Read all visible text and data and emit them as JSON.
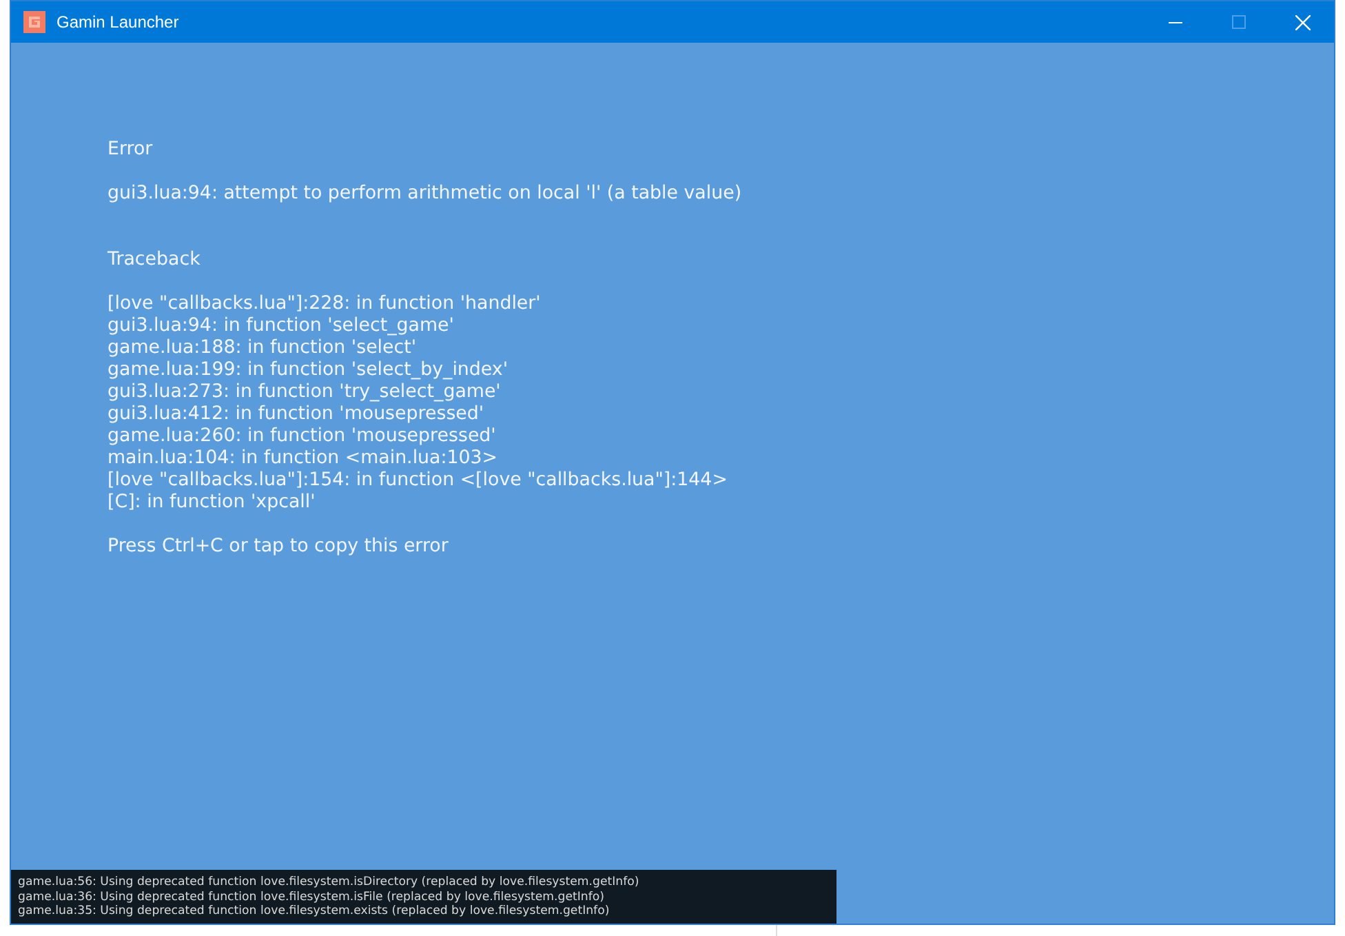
{
  "window": {
    "title": "Gamin Launcher"
  },
  "error": {
    "heading": "Error",
    "message": "gui3.lua:94: attempt to perform arithmetic on local 'l' (a table value)",
    "traceback_heading": "Traceback",
    "traceback": [
      "[love \"callbacks.lua\"]:228: in function 'handler'",
      "gui3.lua:94: in function 'select_game'",
      "game.lua:188: in function 'select'",
      "game.lua:199: in function 'select_by_index'",
      "gui3.lua:273: in function 'try_select_game'",
      "gui3.lua:412: in function 'mousepressed'",
      "game.lua:260: in function 'mousepressed'",
      "main.lua:104: in function <main.lua:103>",
      "[love \"callbacks.lua\"]:154: in function <[love \"callbacks.lua\"]:144>",
      "[C]: in function 'xpcall'"
    ],
    "hint": "Press Ctrl+C or tap to copy this error"
  },
  "console": [
    "game.lua:56: Using deprecated function love.filesystem.isDirectory (replaced by love.filesystem.getInfo)",
    "game.lua:36: Using deprecated function love.filesystem.isFile (replaced by love.filesystem.getInfo)",
    "game.lua:35: Using deprecated function love.filesystem.exists (replaced by love.filesystem.getInfo)"
  ]
}
